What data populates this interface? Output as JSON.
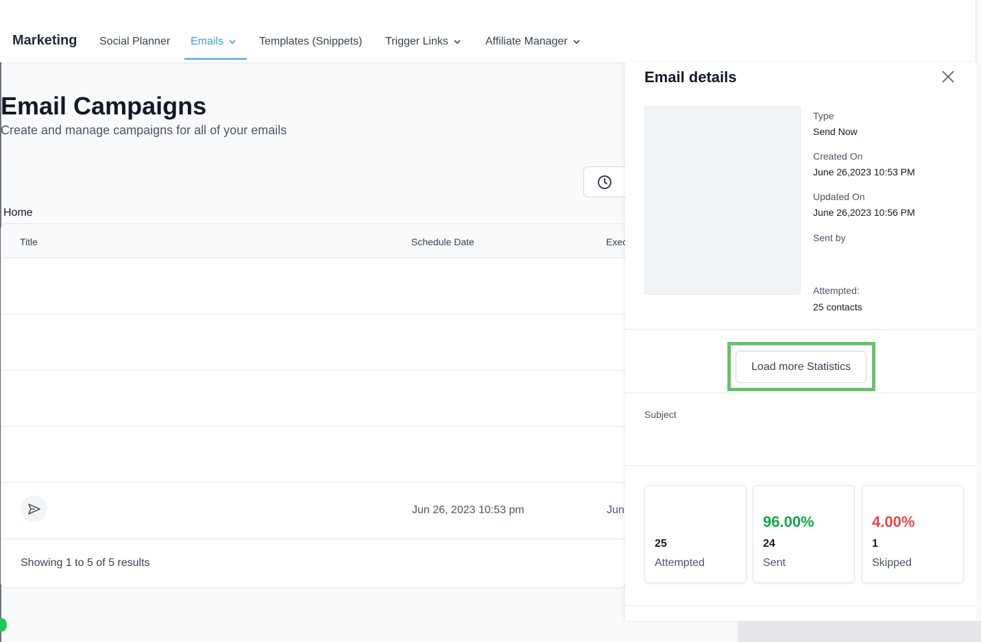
{
  "nav": {
    "brand": "Marketing",
    "items": [
      {
        "label": "Social Planner",
        "active": false,
        "has_dropdown": false
      },
      {
        "label": "Emails",
        "active": true,
        "has_dropdown": true
      },
      {
        "label": "Templates (Snippets)",
        "active": false,
        "has_dropdown": false
      },
      {
        "label": "Trigger Links",
        "active": false,
        "has_dropdown": true
      },
      {
        "label": "Affiliate Manager",
        "active": false,
        "has_dropdown": true
      }
    ]
  },
  "page": {
    "title": "Email Campaigns",
    "subtitle": "Create and manage campaigns for all of your emails",
    "breadcrumb": "Home"
  },
  "table": {
    "columns": [
      "Title",
      "Schedule Date",
      "Exec"
    ],
    "rows": [
      {
        "schedule_date": "",
        "executed": ""
      },
      {
        "schedule_date": "",
        "executed": ""
      },
      {
        "schedule_date": "",
        "executed": ""
      },
      {
        "schedule_date": "",
        "executed": ""
      },
      {
        "schedule_date": "Jun 26, 2023 10:53 pm",
        "executed": "Jun"
      }
    ],
    "footer": "Showing 1 to 5 of 5 results"
  },
  "drawer": {
    "title": "Email details",
    "type_label": "Type",
    "type_value": "Send Now",
    "created_label": "Created On",
    "created_value": "June 26,2023 10:53 PM",
    "updated_label": "Updated On",
    "updated_value": "June 26,2023 10:56 PM",
    "sent_by_label": "Sent by",
    "attempted_label": "Attempted:",
    "attempted_value": "25 contacts",
    "load_more": "Load more Statistics",
    "subject_label": "Subject",
    "stats": [
      {
        "percent": "",
        "count": "25",
        "label": "Attempted",
        "color": "#111827"
      },
      {
        "percent": "96.00%",
        "count": "24",
        "label": "Sent",
        "color": "#16a34a"
      },
      {
        "percent": "4.00%",
        "count": "1",
        "label": "Skipped",
        "color": "#ef4444"
      }
    ]
  },
  "colors": {
    "accent": "#3b9fd6",
    "highlight": "#6abf6f",
    "success": "#16a34a",
    "danger": "#ef4444"
  },
  "icons": [
    "chevron-down-icon",
    "clock-icon",
    "send-icon",
    "close-icon"
  ]
}
